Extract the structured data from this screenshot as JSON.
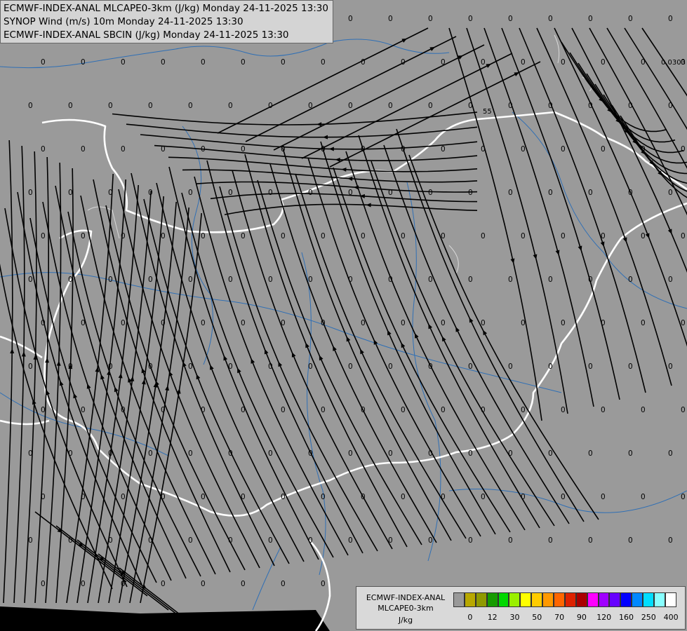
{
  "header": {
    "line1": "ECMWF-INDEX-ANAL MLCAPE0-3km (J/kg) Monday 24-11-2025 13:30",
    "line2": "SYNOP Wind (m/s) 10m Monday 24-11-2025 13:30",
    "line3": "ECMWF-INDEX-ANAL SBCIN (J/kg) Monday 24-11-2025 13:30"
  },
  "map_labels": {
    "zero": "0",
    "value_ne": "0.0303",
    "value_55": "55"
  },
  "legend": {
    "title_line1": "ECMWF-INDEX-ANAL",
    "title_line2": "MLCAPE0-3km",
    "unit": "J/kg",
    "colors": [
      "#999999",
      "#b8a800",
      "#8f9a00",
      "#169b00",
      "#00d800",
      "#9af000",
      "#ffff00",
      "#ffcc00",
      "#ff9900",
      "#ff6600",
      "#dd2200",
      "#aa0000",
      "#ff00ff",
      "#a000ff",
      "#6600ff",
      "#0000ff",
      "#0088ff",
      "#00ddff",
      "#88ffff",
      "#ffffff"
    ],
    "ticks": [
      "0",
      "12",
      "30",
      "50",
      "70",
      "90",
      "120",
      "160",
      "250",
      "400"
    ]
  }
}
